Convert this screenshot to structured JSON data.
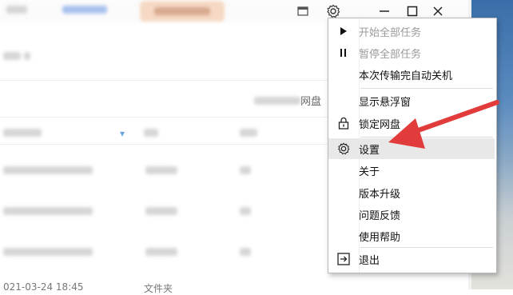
{
  "menu": {
    "items": [
      {
        "label": "开始全部任务",
        "icon": "play-icon",
        "disabled": true
      },
      {
        "label": "暂停全部任务",
        "icon": "pause-icon",
        "disabled": true
      },
      {
        "label": "本次传输完自动关机",
        "icon": "",
        "disabled": false
      },
      {
        "label": "显示悬浮窗",
        "icon": "",
        "disabled": false
      },
      {
        "label": "锁定网盘",
        "icon": "lock-icon",
        "disabled": false
      },
      {
        "label": "设置",
        "icon": "gear-icon",
        "disabled": false,
        "highlighted": true
      },
      {
        "label": "关于",
        "icon": "",
        "disabled": false
      },
      {
        "label": "版本升级",
        "icon": "",
        "disabled": false
      },
      {
        "label": "问题反馈",
        "icon": "",
        "disabled": false
      },
      {
        "label": "使用帮助",
        "icon": "",
        "disabled": false
      },
      {
        "label": "退出",
        "icon": "exit-icon",
        "disabled": false
      }
    ]
  },
  "window": {
    "partial_text_right": "网盘",
    "bottom_row_date": "021-03-24 18:45",
    "bottom_row_type": "文件夹"
  },
  "colors": {
    "arrow": "#e23b3b",
    "menu_hover": "#e8e8e8",
    "disabled_text": "#9a9a9a"
  }
}
